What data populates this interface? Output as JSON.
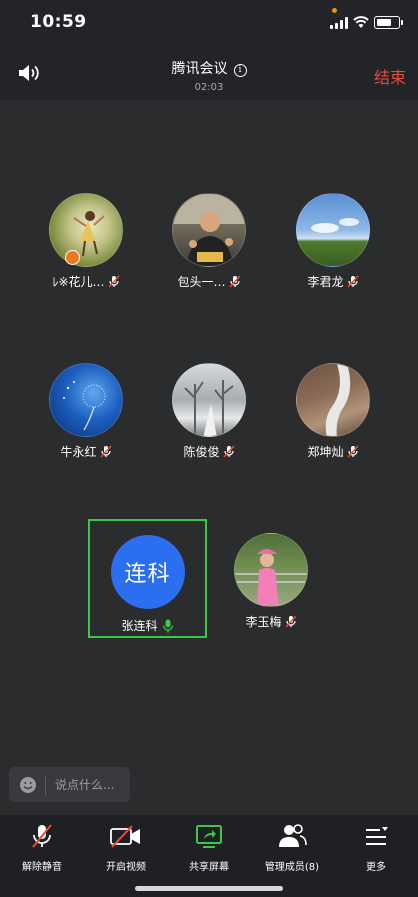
{
  "status_bar": {
    "time": "10:59",
    "signal_icon": "signal-icon",
    "wifi_icon": "wifi-icon",
    "battery_icon": "battery-icon"
  },
  "header": {
    "title": "腾讯会议",
    "duration": "02:03",
    "end_label": "结束",
    "speaker_icon": "speaker-icon",
    "info_icon": "info-icon",
    "end_color": "#e84a3c"
  },
  "participants": [
    {
      "name": "ﾚ※花儿…",
      "muted": true,
      "host": true
    },
    {
      "name": "包头一…",
      "muted": true
    },
    {
      "name": "李君龙",
      "muted": true
    },
    {
      "name": "牛永红",
      "muted": true
    },
    {
      "name": "陈俊俊",
      "muted": true
    },
    {
      "name": "郑坤灿",
      "muted": true
    },
    {
      "name": "张连科",
      "muted": false,
      "avatar_text": "连科",
      "selected": true
    },
    {
      "name": "李玉梅",
      "muted": true
    }
  ],
  "chat": {
    "placeholder": "说点什么..."
  },
  "toolbar": [
    {
      "label": "解除静音",
      "icon": "mic-muted-icon"
    },
    {
      "label": "开启视频",
      "icon": "camera-off-icon"
    },
    {
      "label": "共享屏幕",
      "icon": "share-screen-icon"
    },
    {
      "label": "管理成员(8)",
      "icon": "members-icon"
    },
    {
      "label": "更多",
      "icon": "more-icon"
    }
  ],
  "colors": {
    "accent_green": "#3ec64a",
    "avatar_blue": "#2b6ef0",
    "background": "#2b2c2e"
  }
}
